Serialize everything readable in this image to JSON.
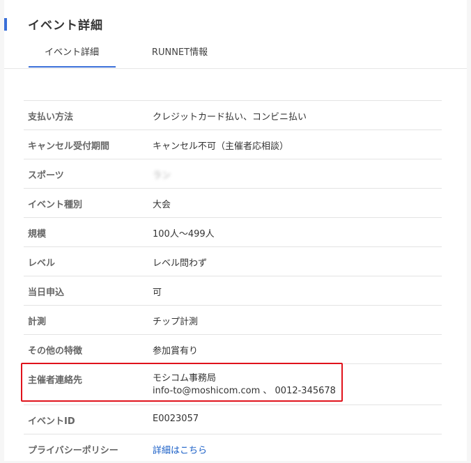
{
  "page": {
    "title": "イベント詳細"
  },
  "tabs": [
    {
      "label": "イベント詳細",
      "active": true
    },
    {
      "label": "RUNNET情報",
      "active": false
    }
  ],
  "colors": {
    "accent": "#3a6fd8",
    "highlight": "#e0121b",
    "link": "#1a5fc7"
  },
  "details": [
    {
      "label": "支払い方法",
      "value": "クレジットカード払い、コンビニ払い"
    },
    {
      "label": "キャンセル受付期間",
      "value": "キャンセル不可（主催者応相談）"
    },
    {
      "label": "スポーツ",
      "value": "ラン"
    },
    {
      "label": "イベント種別",
      "value": "大会"
    },
    {
      "label": "規模",
      "value": "100人～499人"
    },
    {
      "label": "レベル",
      "value": "レベル問わず"
    },
    {
      "label": "当日申込",
      "value": "可"
    },
    {
      "label": "計測",
      "value": "チップ計測"
    },
    {
      "label": "その他の特徴",
      "value": "参加賞有り"
    },
    {
      "label": "主催者連絡先",
      "value_line1": "モシコム事務局",
      "value_line2": "info-to@moshicom.com 、 0012-345678"
    },
    {
      "label": "イベントID",
      "value": "E0023057"
    },
    {
      "label": "プライバシーポリシー",
      "value": "詳細はこちら"
    }
  ]
}
